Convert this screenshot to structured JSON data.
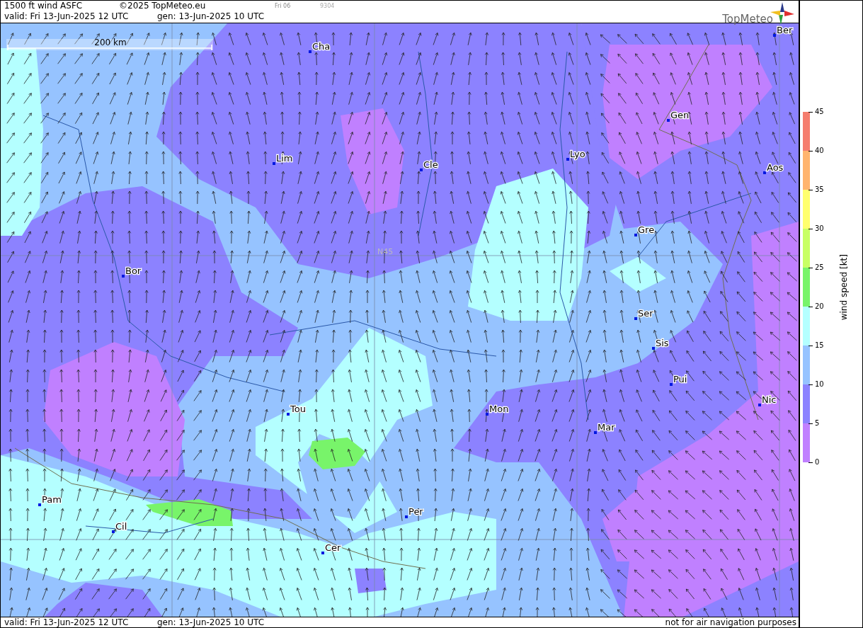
{
  "header": {
    "title": "1500 ft wind ASFC",
    "copyright": "©2025 TopMeteo.eu",
    "day_code": "Fri 06",
    "run_code": "9304",
    "valid": "valid:  Fri  13-Jun-2025  12 UTC",
    "generated": "gen: 13-Jun-2025 10 UTC",
    "logo": "TopMeteo"
  },
  "map": {
    "scale": "200 km",
    "latitude_label": "N45",
    "cities": [
      {
        "name": "Ber"
      },
      {
        "name": "Cha"
      },
      {
        "name": "Gen"
      },
      {
        "name": "Lim"
      },
      {
        "name": "Lyo"
      },
      {
        "name": "Cle"
      },
      {
        "name": "Aos"
      },
      {
        "name": "Gre"
      },
      {
        "name": "Bor"
      },
      {
        "name": "Ser"
      },
      {
        "name": "Sis"
      },
      {
        "name": "Pui"
      },
      {
        "name": "Nic"
      },
      {
        "name": "Tou"
      },
      {
        "name": "Mon"
      },
      {
        "name": "Mar"
      },
      {
        "name": "Pam"
      },
      {
        "name": "Per"
      },
      {
        "name": "Cil"
      },
      {
        "name": "Cer"
      }
    ]
  },
  "legend": {
    "title": "wind  speed  [kt]",
    "top_label": "45",
    "bands": [
      {
        "label": "40",
        "color": "#f57d6e"
      },
      {
        "label": "35",
        "color": "#ffb46e"
      },
      {
        "label": "30",
        "color": "#ffff6e"
      },
      {
        "label": "25",
        "color": "#c8ff64"
      },
      {
        "label": "20",
        "color": "#78f46a"
      },
      {
        "label": "15",
        "color": "#b4ffff"
      },
      {
        "label": "10",
        "color": "#96c3ff"
      },
      {
        "label": "5",
        "color": "#8c82ff"
      },
      {
        "label": "0",
        "color": "#c080ff"
      }
    ]
  },
  "footer": {
    "valid": "valid:  Fri  13-Jun-2025  12 UTC",
    "generated": "gen: 13-Jun-2025 10 UTC",
    "notice": "not for air navigation purposes"
  }
}
